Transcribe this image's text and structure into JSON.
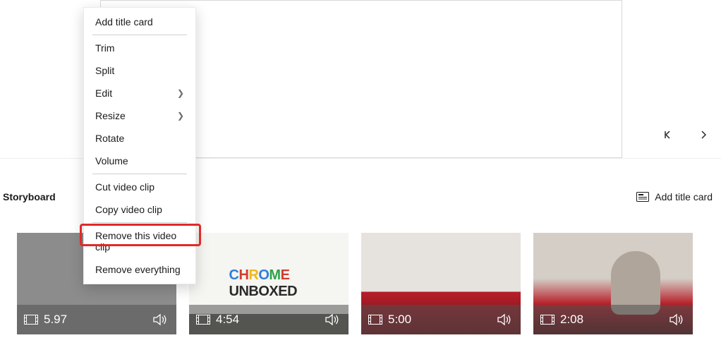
{
  "contextMenu": {
    "items": [
      {
        "label": "Add title card",
        "submenu": false
      },
      {
        "label": "Trim",
        "submenu": false
      },
      {
        "label": "Split",
        "submenu": false
      },
      {
        "label": "Edit",
        "submenu": true
      },
      {
        "label": "Resize",
        "submenu": true
      },
      {
        "label": "Rotate",
        "submenu": false
      },
      {
        "label": "Volume",
        "submenu": false
      },
      {
        "label": "Cut video clip",
        "submenu": false
      },
      {
        "label": "Copy video clip",
        "submenu": false
      },
      {
        "label": "Remove this video clip",
        "submenu": false
      },
      {
        "label": "Remove everything",
        "submenu": false
      }
    ],
    "highlightedIndex": 9
  },
  "storyboard": {
    "title": "Storyboard",
    "addTitleCardLabel": "Add title card"
  },
  "clips": [
    {
      "duration": "5.97",
      "selected": true,
      "logoText": ""
    },
    {
      "duration": "4:54",
      "selected": false,
      "logoText": "CHROME UNBOXED"
    },
    {
      "duration": "5:00",
      "selected": false,
      "logoText": ""
    },
    {
      "duration": "2:08",
      "selected": false,
      "logoText": ""
    }
  ]
}
